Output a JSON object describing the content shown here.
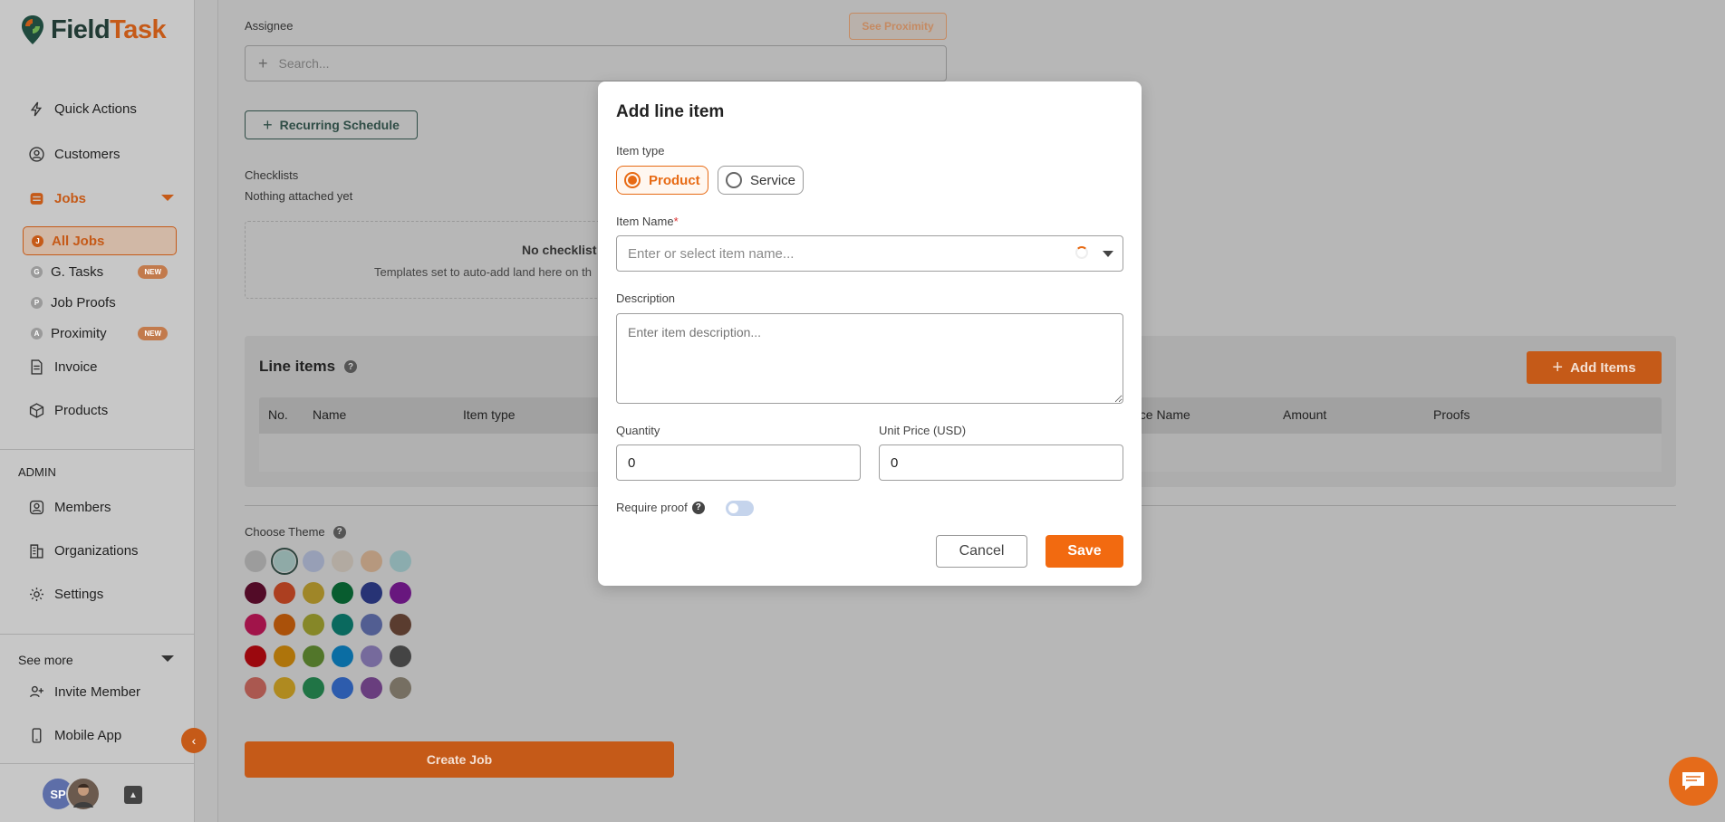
{
  "brand": {
    "name_part1": "Field",
    "name_part2": "Task",
    "accent": "#C55A18"
  },
  "sidebar": {
    "items": [
      {
        "label": "Quick Actions",
        "icon": "lightning-icon"
      },
      {
        "label": "Customers",
        "icon": "person-circle-icon"
      },
      {
        "label": "Jobs",
        "icon": "jobs-icon"
      },
      {
        "label": "Invoice",
        "icon": "invoice-icon"
      },
      {
        "label": "Products",
        "icon": "box-icon"
      }
    ],
    "job_subitems": [
      {
        "letter": "J",
        "label": "All Jobs"
      },
      {
        "letter": "G",
        "label": "G. Tasks",
        "badge": "NEW"
      },
      {
        "letter": "P",
        "label": "Job Proofs"
      },
      {
        "letter": "A",
        "label": "Proximity",
        "badge": "NEW"
      }
    ],
    "admin_title": "ADMIN",
    "admin_items": [
      {
        "label": "Members"
      },
      {
        "label": "Organizations"
      },
      {
        "label": "Settings"
      }
    ],
    "see_more": "See more",
    "more_items": [
      {
        "label": "Invite Member"
      },
      {
        "label": "Mobile App"
      }
    ],
    "avatar_initials": "SP"
  },
  "form": {
    "assignee_label": "Assignee",
    "see_proximity": "See Proximity",
    "search_placeholder": "Search...",
    "recurring_schedule": "Recurring Schedule",
    "checklists_label": "Checklists",
    "checklists_empty": "Nothing attached yet",
    "no_checklist": "No checklist",
    "templates_hint": "Templates set to auto-add land here on th",
    "line_items_title": "Line items",
    "add_items": "Add Items",
    "columns": [
      "No.",
      "Name",
      "Item type",
      "rice Name",
      "Amount",
      "Proofs"
    ],
    "choose_theme": "Choose Theme",
    "create_job": "Create Job"
  },
  "theme_swatches": [
    [
      "#d0d0d0",
      "#bfe3df",
      "#c9d4f2",
      "#ede2d6",
      "#f2cba8",
      "#b9e5e8"
    ],
    [
      "#6e0f34",
      "#e5542a",
      "#d4b335",
      "#0b7a3f",
      "#34449c",
      "#8a1fa8"
    ],
    [
      "#d61a63",
      "#e36c0d",
      "#b3b435",
      "#0d8c7e",
      "#6d7ec2",
      "#78503f"
    ],
    [
      "#cf0a12",
      "#e89b0f",
      "#6e9e38",
      "#0e91d9",
      "#9e8ed0",
      "#5a5a5a"
    ],
    [
      "#e2756a",
      "#e9b82b",
      "#2a9a5c",
      "#3c7be6",
      "#8c53a8",
      "#9e9483"
    ]
  ],
  "modal": {
    "title": "Add line item",
    "item_type_label": "Item type",
    "type_options": [
      "Product",
      "Service"
    ],
    "selected_type": "Product",
    "item_name_label": "Item Name",
    "required_mark": "*",
    "item_name_placeholder": "Enter or select item name...",
    "description_label": "Description",
    "description_placeholder": "Enter item description...",
    "quantity_label": "Quantity",
    "quantity_value": "0",
    "unit_price_label": "Unit Price (USD)",
    "unit_price_value": "0",
    "require_proof_label": "Require proof",
    "require_proof_on": false,
    "cancel": "Cancel",
    "save": "Save"
  }
}
